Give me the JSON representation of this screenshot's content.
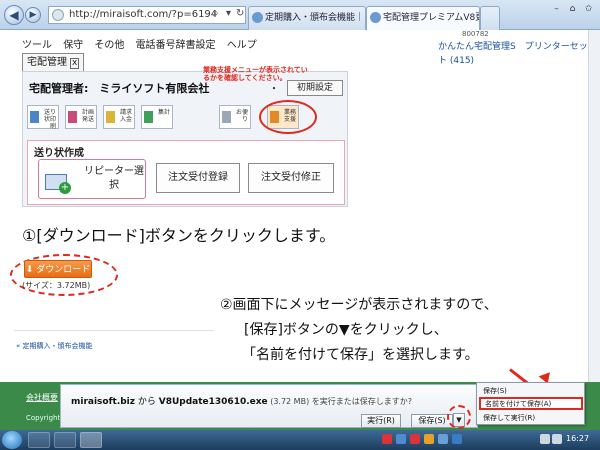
{
  "browser": {
    "address": "http://miraisoft.com/?p=6194",
    "search_icon": "search-icon",
    "tabs": [
      {
        "label": "定期購入・頒布会機能｜ミラ..."
      },
      {
        "label": "宅配管理プレミアムV8更..."
      }
    ]
  },
  "sidebar": {
    "top_label": "800782",
    "link": "かんたん宅配管理S　プリンターセット (415)"
  },
  "app": {
    "menu": [
      "ツール",
      "保守",
      "その他",
      "電話番号辞書設定",
      "ヘルプ"
    ],
    "tab_label": "宅配管理",
    "tab_close": "x",
    "company": "宅配管理者:　ミライソフト有限会社",
    "dot": "・",
    "init_button": "初期設定",
    "note": "業務支援メニューが表示されているかを確認してください。",
    "tiles": [
      {
        "label": "送り状印刷"
      },
      {
        "label": "計画発送"
      },
      {
        "label": "請求入金"
      },
      {
        "label": "集計"
      },
      {
        "label": "お便り"
      },
      {
        "label": "業務支援"
      }
    ],
    "send": {
      "title": "送り状作成",
      "repeater": "リピーター選択",
      "order_register": "注文受付登録",
      "order_edit": "注文受付修正"
    }
  },
  "instructions": {
    "step1": "①[ダウンロード]ボタンをクリックします。",
    "download_label": "ダウンロード",
    "download_size": "(サイズ：3.72MB)",
    "step2_line1": "②画面下にメッセージが表示されますので、",
    "step2_line2": "[保存]ボタンの▼をクリックし、",
    "step2_line3": "「名前を付けて保存」を選択します。"
  },
  "back_link": "« 定期購入・頒布会機能",
  "footer": {
    "link": "会社概要",
    "copyright": "Copyright"
  },
  "download_bar": {
    "site": "miraisoft.biz",
    "from": " から ",
    "file": "V8Update130610.exe",
    "size": " (3.72 MB) ",
    "question": "を実行または保存しますか?",
    "run": "実行(R)",
    "save": "保存(S)",
    "save_arrow": "▼",
    "close": "×"
  },
  "save_menu": {
    "items": [
      "保存(S)",
      "名前を付けて保存(A)",
      "保存して実行(R)"
    ]
  },
  "taskbar": {
    "clock": "16:27"
  }
}
